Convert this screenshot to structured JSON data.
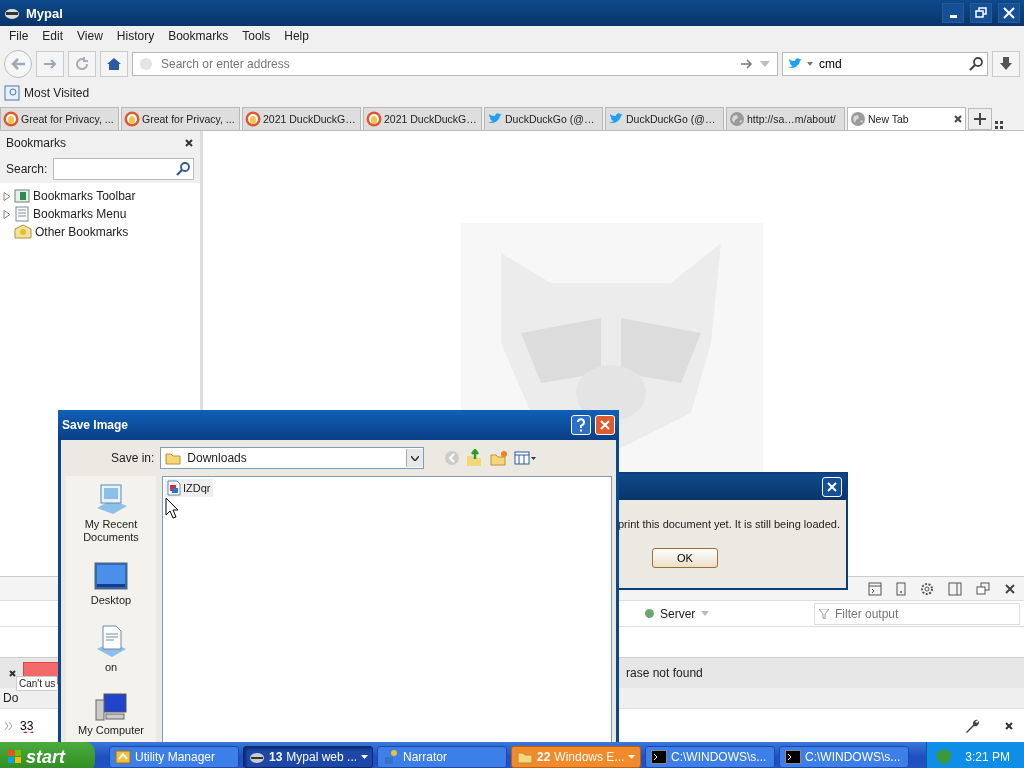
{
  "window": {
    "title": "Mypal"
  },
  "menu": [
    "File",
    "Edit",
    "View",
    "History",
    "Bookmarks",
    "Tools",
    "Help"
  ],
  "nav": {
    "address_placeholder": "Search or enter address",
    "search_value": "cmd"
  },
  "bookmarks_toolbar": [
    "Most Visited"
  ],
  "tabs": [
    {
      "label": "Great for Privacy, ...",
      "kind": "duck",
      "selected": false
    },
    {
      "label": "Great for Privacy, ...",
      "kind": "duck",
      "selected": false
    },
    {
      "label": "2021 DuckDuckG…",
      "kind": "duck",
      "selected": false
    },
    {
      "label": "2021 DuckDuckG…",
      "kind": "duck",
      "selected": false
    },
    {
      "label": "DuckDuckGo (@…",
      "kind": "bird",
      "selected": false
    },
    {
      "label": "DuckDuckGo (@…",
      "kind": "bird",
      "selected": false
    },
    {
      "label": "http://sa…m/about/",
      "kind": "globe",
      "selected": false
    },
    {
      "label": "New Tab",
      "kind": "globe",
      "selected": true
    }
  ],
  "sidebar": {
    "title": "Bookmarks",
    "search_label": "Search:",
    "items": [
      {
        "label": "Bookmarks Toolbar",
        "kind": "toolbar",
        "expanded": false
      },
      {
        "label": "Bookmarks Menu",
        "kind": "menu",
        "expanded": false
      },
      {
        "label": "Other Bookmarks",
        "kind": "other"
      }
    ]
  },
  "content": {
    "kind": "picture"
  },
  "devtools": {
    "target": "Server",
    "filter_placeholder": "Filter output"
  },
  "find_bar": {
    "status": "rase not found",
    "tooltip": "Can't us"
  },
  "status_text": "Do",
  "command_line": {
    "value": "33"
  },
  "alert": {
    "message": "print this document yet. It is still being loaded.",
    "button": "OK"
  },
  "save_dialog": {
    "title": "Save Image",
    "save_in_label": "Save in:",
    "folder": "Downloads",
    "places": [
      {
        "label": "My Recent Documents",
        "kind": "recent"
      },
      {
        "label": "Desktop",
        "kind": "desktop"
      },
      {
        "label": "on",
        "kind": "documents"
      },
      {
        "label": "My Computer",
        "kind": "computer"
      }
    ],
    "files": [
      {
        "name": "IZDqr"
      }
    ]
  },
  "taskbar": {
    "start": "start",
    "clock": "3:21 PM",
    "items": [
      {
        "label": "Utility Manager",
        "kind": "utility",
        "selected": false,
        "flashing": false
      },
      {
        "count": "13",
        "label": "Mypal web ...",
        "kind": "mypal",
        "selected": true,
        "flashing": false
      },
      {
        "label": "Narrator",
        "kind": "narrator",
        "selected": false,
        "flashing": false
      },
      {
        "count": "22",
        "label": "Windows E...",
        "kind": "folder",
        "selected": false,
        "flashing": true
      },
      {
        "label": "C:\\WINDOWS\\s...",
        "kind": "console",
        "selected": false,
        "flashing": false
      },
      {
        "label": "C:\\WINDOWS\\s...",
        "kind": "console",
        "selected": false,
        "flashing": false
      }
    ]
  }
}
